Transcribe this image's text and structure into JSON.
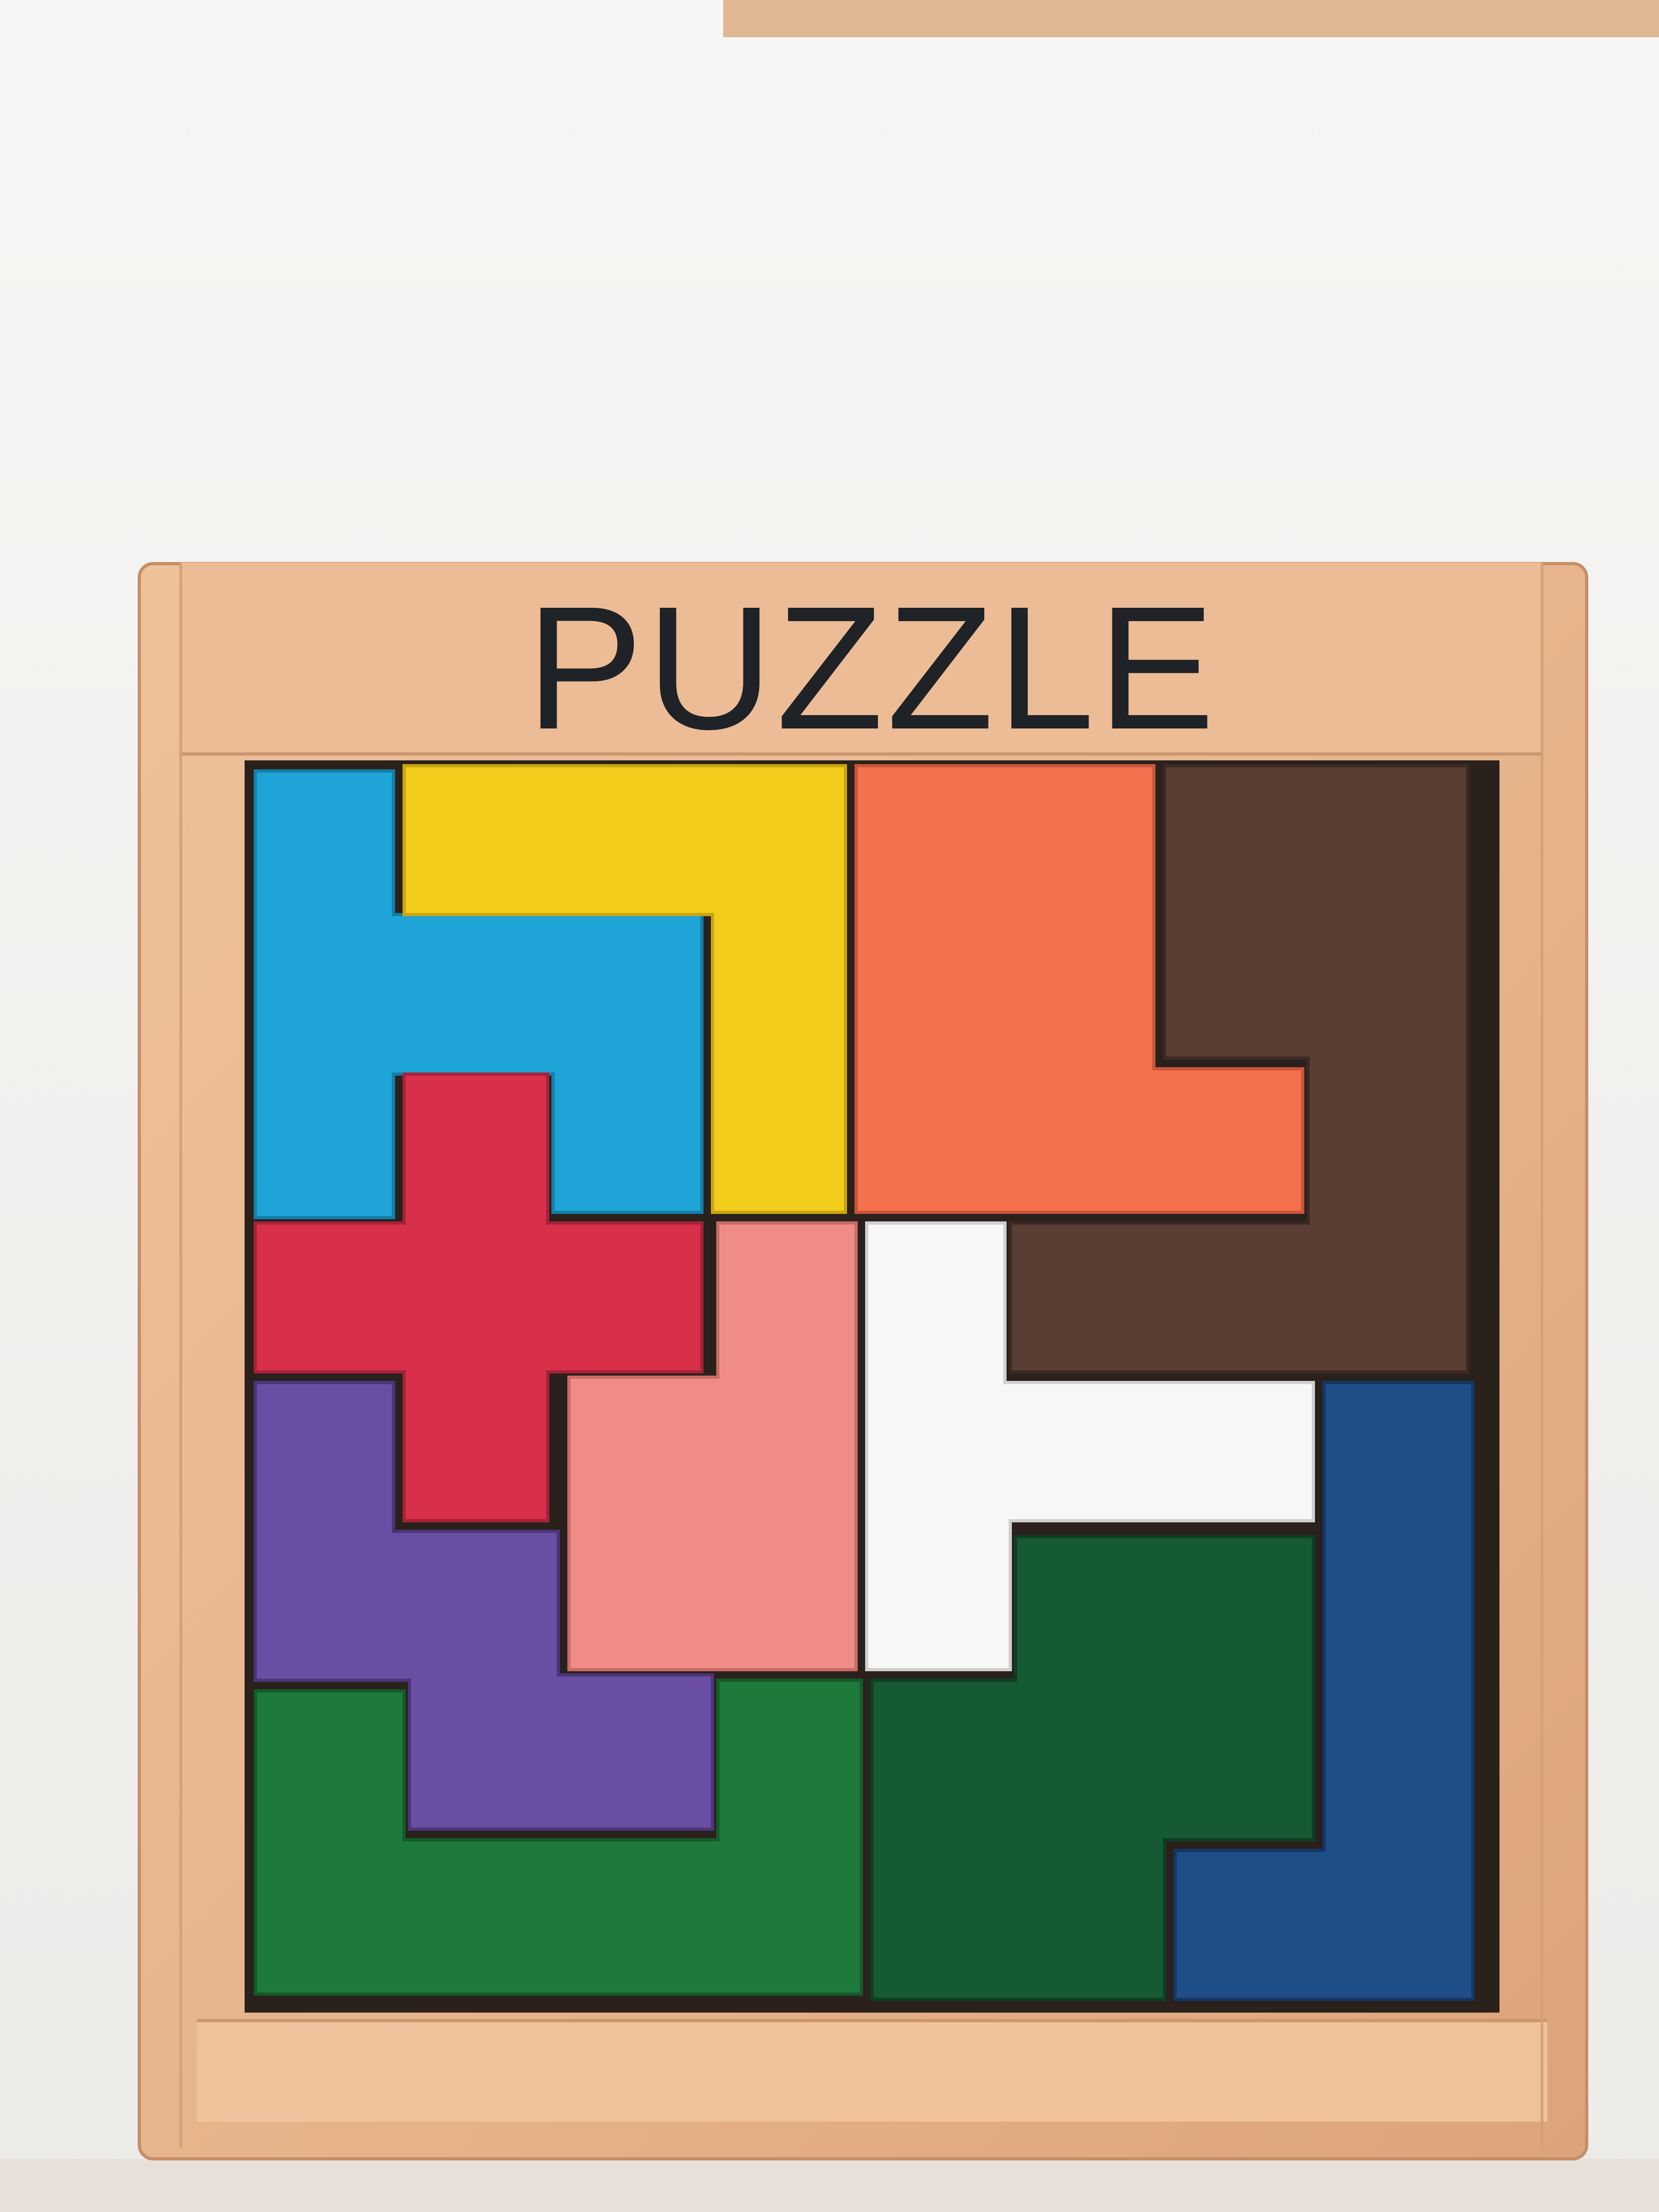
{
  "tray": {
    "title": "PUZZLE"
  },
  "colors": {
    "background": "#f5f5f3",
    "wood": "#e7b58d",
    "wood_light": "#f0c8a3",
    "wood_dark": "#cf9a70",
    "tray_floor": "#2a211c",
    "title_ink": "#1f2226"
  },
  "pieces": [
    {
      "name": "cyan-piece",
      "color": "#1ea4d6"
    },
    {
      "name": "yellow-piece",
      "color": "#f2cc1a"
    },
    {
      "name": "orange-piece",
      "color": "#f4714e"
    },
    {
      "name": "brown-piece",
      "color": "#5a3d33"
    },
    {
      "name": "red-piece",
      "color": "#d8304a"
    },
    {
      "name": "pink-piece",
      "color": "#f08c86"
    },
    {
      "name": "white-piece",
      "color": "#f7f7f7"
    },
    {
      "name": "purple-piece",
      "color": "#6a4ea3"
    },
    {
      "name": "navy-piece",
      "color": "#1f4d88"
    },
    {
      "name": "green-piece",
      "color": "#1e7a3c"
    },
    {
      "name": "dark-green-piece",
      "color": "#155a33"
    }
  ]
}
